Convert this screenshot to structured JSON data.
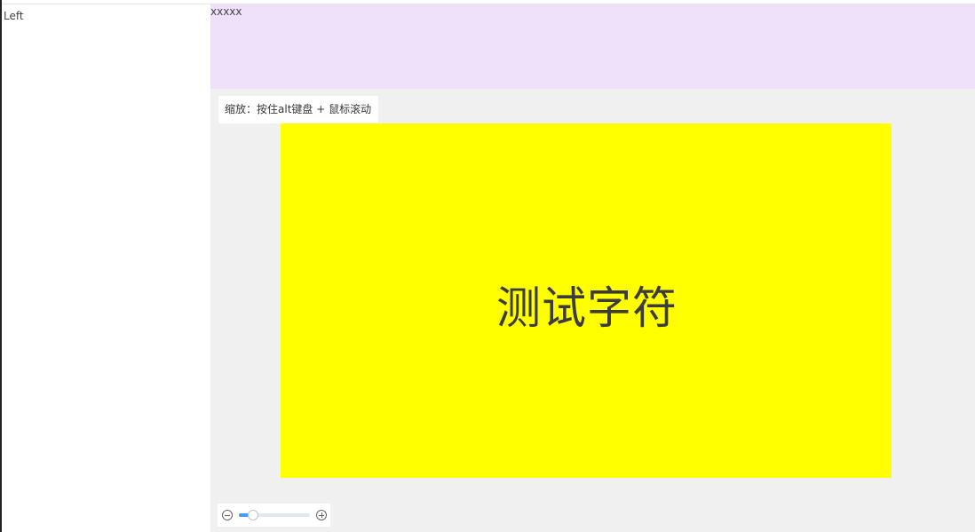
{
  "left_panel": {
    "label": "Left"
  },
  "header": {
    "label": "xxxxx"
  },
  "content": {
    "hint": "缩放：按住alt键盘 + 鼠标滚动",
    "canvas_text": "测试字符"
  },
  "zoom": {
    "zoom_out_icon": "minus-circle-icon",
    "zoom_in_icon": "plus-circle-icon",
    "slider_level": 0.2
  },
  "colors": {
    "header_bg": "#f0e1fb",
    "content_bg": "#f0f0f0",
    "canvas_bg": "#ffff00",
    "slider_accent": "#409eff"
  }
}
